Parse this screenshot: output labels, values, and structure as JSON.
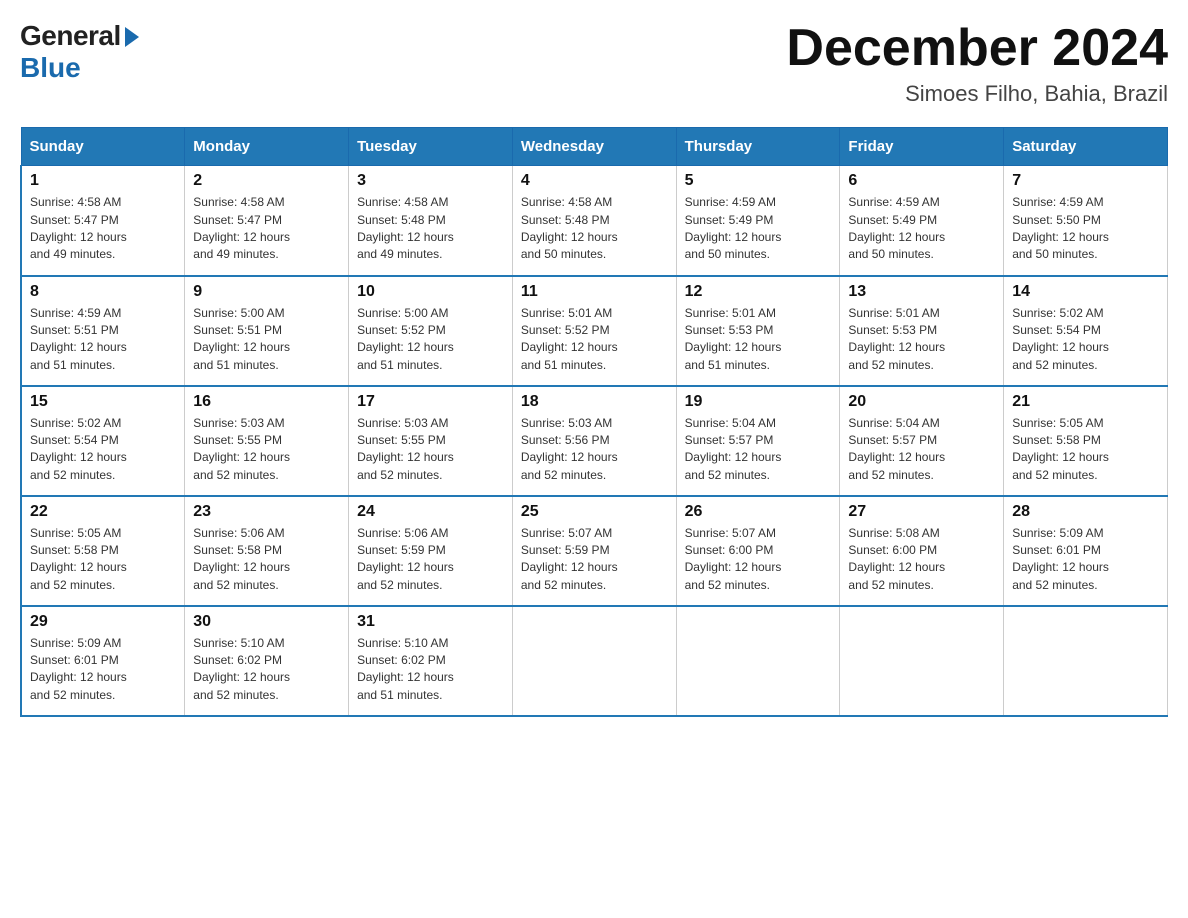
{
  "header": {
    "logo_general": "General",
    "logo_blue": "Blue",
    "month_title": "December 2024",
    "location": "Simoes Filho, Bahia, Brazil"
  },
  "days_of_week": [
    "Sunday",
    "Monday",
    "Tuesday",
    "Wednesday",
    "Thursday",
    "Friday",
    "Saturday"
  ],
  "weeks": [
    [
      {
        "day": "1",
        "sunrise": "4:58 AM",
        "sunset": "5:47 PM",
        "daylight": "12 hours and 49 minutes."
      },
      {
        "day": "2",
        "sunrise": "4:58 AM",
        "sunset": "5:47 PM",
        "daylight": "12 hours and 49 minutes."
      },
      {
        "day": "3",
        "sunrise": "4:58 AM",
        "sunset": "5:48 PM",
        "daylight": "12 hours and 49 minutes."
      },
      {
        "day": "4",
        "sunrise": "4:58 AM",
        "sunset": "5:48 PM",
        "daylight": "12 hours and 50 minutes."
      },
      {
        "day": "5",
        "sunrise": "4:59 AM",
        "sunset": "5:49 PM",
        "daylight": "12 hours and 50 minutes."
      },
      {
        "day": "6",
        "sunrise": "4:59 AM",
        "sunset": "5:49 PM",
        "daylight": "12 hours and 50 minutes."
      },
      {
        "day": "7",
        "sunrise": "4:59 AM",
        "sunset": "5:50 PM",
        "daylight": "12 hours and 50 minutes."
      }
    ],
    [
      {
        "day": "8",
        "sunrise": "4:59 AM",
        "sunset": "5:51 PM",
        "daylight": "12 hours and 51 minutes."
      },
      {
        "day": "9",
        "sunrise": "5:00 AM",
        "sunset": "5:51 PM",
        "daylight": "12 hours and 51 minutes."
      },
      {
        "day": "10",
        "sunrise": "5:00 AM",
        "sunset": "5:52 PM",
        "daylight": "12 hours and 51 minutes."
      },
      {
        "day": "11",
        "sunrise": "5:01 AM",
        "sunset": "5:52 PM",
        "daylight": "12 hours and 51 minutes."
      },
      {
        "day": "12",
        "sunrise": "5:01 AM",
        "sunset": "5:53 PM",
        "daylight": "12 hours and 51 minutes."
      },
      {
        "day": "13",
        "sunrise": "5:01 AM",
        "sunset": "5:53 PM",
        "daylight": "12 hours and 52 minutes."
      },
      {
        "day": "14",
        "sunrise": "5:02 AM",
        "sunset": "5:54 PM",
        "daylight": "12 hours and 52 minutes."
      }
    ],
    [
      {
        "day": "15",
        "sunrise": "5:02 AM",
        "sunset": "5:54 PM",
        "daylight": "12 hours and 52 minutes."
      },
      {
        "day": "16",
        "sunrise": "5:03 AM",
        "sunset": "5:55 PM",
        "daylight": "12 hours and 52 minutes."
      },
      {
        "day": "17",
        "sunrise": "5:03 AM",
        "sunset": "5:55 PM",
        "daylight": "12 hours and 52 minutes."
      },
      {
        "day": "18",
        "sunrise": "5:03 AM",
        "sunset": "5:56 PM",
        "daylight": "12 hours and 52 minutes."
      },
      {
        "day": "19",
        "sunrise": "5:04 AM",
        "sunset": "5:57 PM",
        "daylight": "12 hours and 52 minutes."
      },
      {
        "day": "20",
        "sunrise": "5:04 AM",
        "sunset": "5:57 PM",
        "daylight": "12 hours and 52 minutes."
      },
      {
        "day": "21",
        "sunrise": "5:05 AM",
        "sunset": "5:58 PM",
        "daylight": "12 hours and 52 minutes."
      }
    ],
    [
      {
        "day": "22",
        "sunrise": "5:05 AM",
        "sunset": "5:58 PM",
        "daylight": "12 hours and 52 minutes."
      },
      {
        "day": "23",
        "sunrise": "5:06 AM",
        "sunset": "5:58 PM",
        "daylight": "12 hours and 52 minutes."
      },
      {
        "day": "24",
        "sunrise": "5:06 AM",
        "sunset": "5:59 PM",
        "daylight": "12 hours and 52 minutes."
      },
      {
        "day": "25",
        "sunrise": "5:07 AM",
        "sunset": "5:59 PM",
        "daylight": "12 hours and 52 minutes."
      },
      {
        "day": "26",
        "sunrise": "5:07 AM",
        "sunset": "6:00 PM",
        "daylight": "12 hours and 52 minutes."
      },
      {
        "day": "27",
        "sunrise": "5:08 AM",
        "sunset": "6:00 PM",
        "daylight": "12 hours and 52 minutes."
      },
      {
        "day": "28",
        "sunrise": "5:09 AM",
        "sunset": "6:01 PM",
        "daylight": "12 hours and 52 minutes."
      }
    ],
    [
      {
        "day": "29",
        "sunrise": "5:09 AM",
        "sunset": "6:01 PM",
        "daylight": "12 hours and 52 minutes."
      },
      {
        "day": "30",
        "sunrise": "5:10 AM",
        "sunset": "6:02 PM",
        "daylight": "12 hours and 52 minutes."
      },
      {
        "day": "31",
        "sunrise": "5:10 AM",
        "sunset": "6:02 PM",
        "daylight": "12 hours and 51 minutes."
      },
      null,
      null,
      null,
      null
    ]
  ],
  "labels": {
    "sunrise_prefix": "Sunrise: ",
    "sunset_prefix": "Sunset: ",
    "daylight_prefix": "Daylight: "
  }
}
